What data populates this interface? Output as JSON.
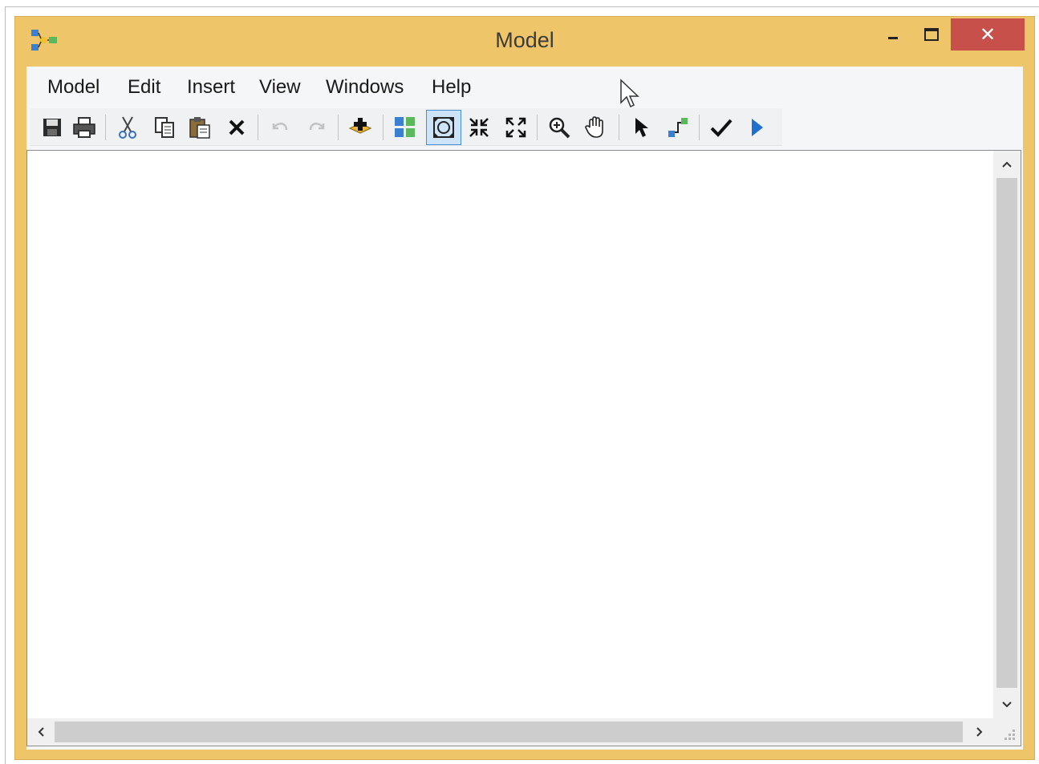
{
  "window": {
    "title": "Model",
    "close_glyph": "✕",
    "accent_color": "#efc56a",
    "close_color": "#c7504a"
  },
  "menu": {
    "items": [
      "Model",
      "Edit",
      "Insert",
      "View",
      "Windows",
      "Help"
    ]
  },
  "toolbar": {
    "icons": [
      "save-icon",
      "print-icon",
      "cut-icon",
      "copy-icon",
      "paste-icon",
      "delete-icon",
      "undo-icon",
      "redo-icon",
      "add-data-icon",
      "auto-layout-icon",
      "full-extent-icon",
      "fixed-zoom-in-icon",
      "fixed-zoom-out-icon",
      "zoom-icon",
      "pan-icon",
      "select-icon",
      "connect-icon",
      "validate-icon",
      "run-icon"
    ],
    "active": "full-extent-icon",
    "disabled": [
      "undo-icon",
      "redo-icon"
    ]
  }
}
